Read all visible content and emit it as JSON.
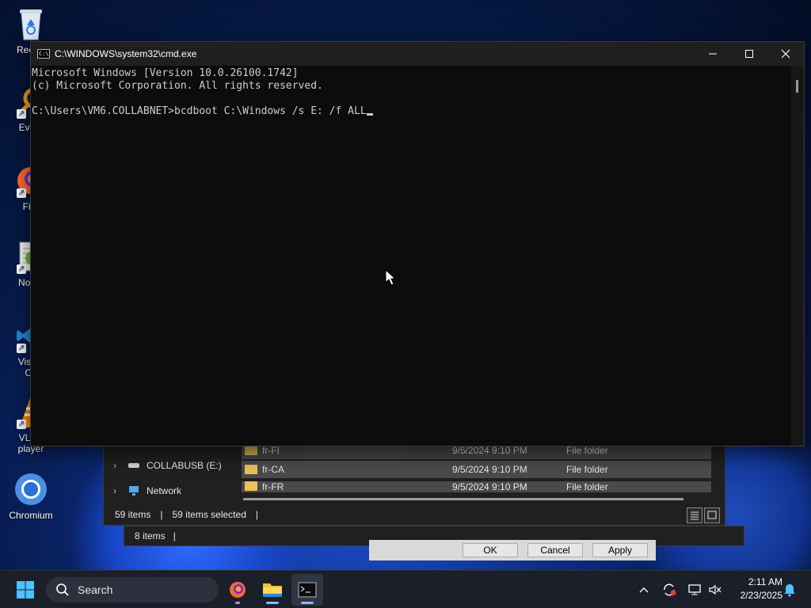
{
  "desktop": {
    "icons": [
      {
        "label": "Recycl",
        "icon": "recycle-bin-icon"
      },
      {
        "label": "Every",
        "icon": "everything-search-icon"
      },
      {
        "label": "Fire",
        "icon": "firefox-icon"
      },
      {
        "label": "Notep",
        "icon": "notepad-plus-plus-icon"
      },
      {
        "label": "Visual",
        "label2": "Co",
        "icon": "vscode-icon"
      },
      {
        "label": "VLC r",
        "label2": "player",
        "icon": "vlc-icon"
      },
      {
        "label": "Chromium",
        "icon": "chromium-icon"
      }
    ]
  },
  "explorer": {
    "nav": [
      {
        "label": "COLLABUSB (E:)",
        "icon": "drive-icon"
      },
      {
        "label": "Network",
        "icon": "network-icon"
      }
    ],
    "rows": [
      {
        "name": "fr-FI",
        "date": "9/5/2024 9:10 PM",
        "type": "File folder"
      },
      {
        "name": "fr-CA",
        "date": "9/5/2024 9:10 PM",
        "type": "File folder"
      },
      {
        "name": "fr-FR",
        "date": "9/5/2024 9:10 PM",
        "type": "File folder"
      }
    ],
    "status_items": "59 items",
    "status_selected": "59 items selected",
    "status_separator": "|"
  },
  "explorer2": {
    "status_items": "8 items",
    "separator": "|"
  },
  "dialog": {
    "ok_label": "OK",
    "cancel_label": "Cancel",
    "apply_label": "Apply"
  },
  "cmd": {
    "title": "C:\\WINDOWS\\system32\\cmd.exe",
    "icon_text": "C:\\",
    "lines": [
      "Microsoft Windows [Version 10.0.26100.1742]",
      "(c) Microsoft Corporation. All rights reserved.",
      "",
      "C:\\Users\\VM6.COLLABNET>bcdboot C:\\Windows /s E: /f ALL"
    ],
    "minimize_glyph": "─",
    "maximize_glyph": "☐",
    "close_glyph": "✕"
  },
  "taskbar": {
    "search_label": "Search",
    "time": "2:11 AM",
    "date": "2/23/2025",
    "apps": [
      "firefox-icon",
      "file-explorer-icon",
      "terminal-icon"
    ],
    "accent": "#8fb4ff"
  }
}
